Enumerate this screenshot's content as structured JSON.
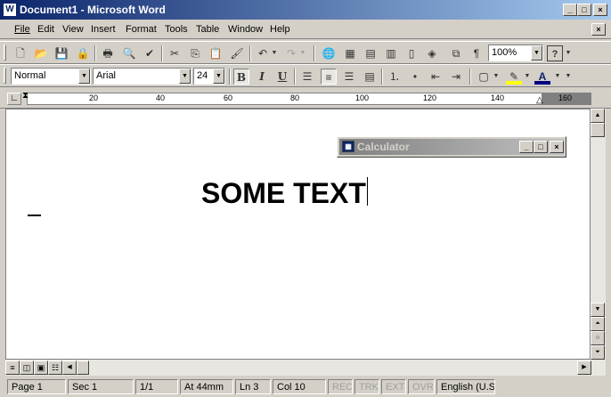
{
  "window": {
    "title": "Document1 - Microsoft Word",
    "doc_close": "×"
  },
  "menu": [
    "File",
    "Edit",
    "View",
    "Insert",
    "Format",
    "Tools",
    "Table",
    "Window",
    "Help"
  ],
  "toolbar": {
    "zoom": "100%",
    "help_icon": "?"
  },
  "format": {
    "style": "Normal",
    "font": "Arial",
    "size": "24",
    "bold": "B",
    "italic": "I",
    "underline": "U",
    "font_color_label": "A"
  },
  "ruler": {
    "ticks": [
      "20",
      "40",
      "60",
      "80",
      "100",
      "120",
      "140",
      "160"
    ]
  },
  "document": {
    "text": "SOME TEXT"
  },
  "calculator": {
    "title": "Calculator"
  },
  "status": {
    "page": "Page 1",
    "sec": "Sec 1",
    "pages": "1/1",
    "at": "At 44mm",
    "ln": "Ln 3",
    "col": "Col 10",
    "rec": "REC",
    "trk": "TRK",
    "ext": "EXT",
    "ovr": "OVR",
    "lang": "English (U.S"
  },
  "colors": {
    "title_active": "#0a246a",
    "title_inactive": "#808080",
    "face": "#d4d0c8"
  }
}
